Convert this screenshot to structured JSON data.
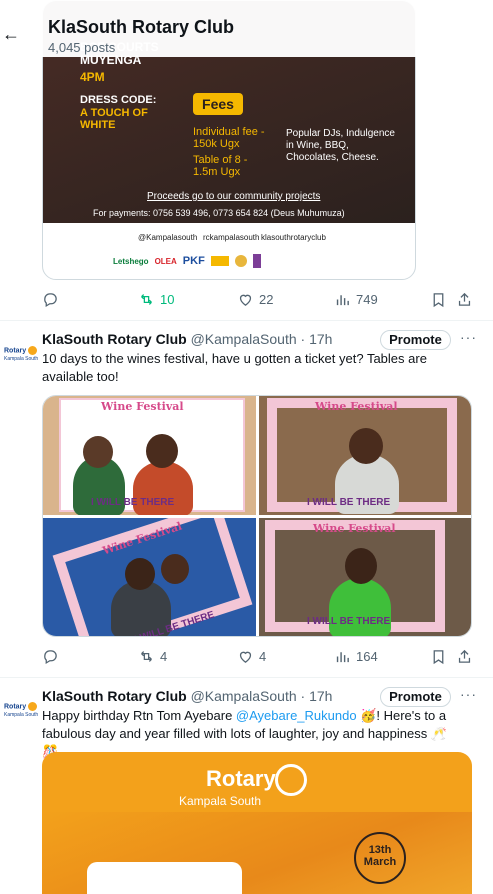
{
  "header": {
    "back_icon": "arrow-left-icon",
    "title": "KlaSouth Rotary Club",
    "posts_count": "4,045 posts"
  },
  "post1": {
    "flyer": {
      "venue": "BCF COURTS MUYENGA",
      "time": "4PM",
      "dress_code_label": "DRESS CODE:",
      "dress_code_value": "A TOUCH OF WHITE",
      "fees_label": "Fees",
      "individual_fee": "Individual fee - 150k Ugx",
      "table_fee": "Table of 8 - 1.5m Ugx",
      "popular": "Popular DJs, Indulgence in Wine, BBQ, Chocolates, Cheese.",
      "proceeds": "Proceeds go to our community projects",
      "payments": "For payments: 0756 539 496, 0773 654 824 (Deus Muhumuza)",
      "social_1": "@Kampalasouth",
      "social_2": "rckampalasouth",
      "social_3": "klasouthrotaryclub",
      "sponsor_1": "Letshego",
      "sponsor_2": "OLEA",
      "sponsor_3": "PKF"
    },
    "actions": {
      "retweets": "10",
      "likes": "22",
      "views": "749"
    }
  },
  "post2": {
    "avatar_text": "Rotary",
    "avatar_sub": "Kampala South",
    "author": "KlaSouth Rotary Club",
    "handle": "@KampalaSouth",
    "time": "· 17h",
    "promote_label": "Promote",
    "text": "10 days to the wines festival, have u gotten a ticket yet? Tables are available too!",
    "photo_frame_title": "Wine Festival",
    "photo_frame_tagline": "I WILL BE THERE",
    "actions": {
      "replies": "",
      "retweets": "4",
      "likes": "4",
      "views": "164"
    }
  },
  "post3": {
    "avatar_text": "Rotary",
    "avatar_sub": "Kampala South",
    "author": "KlaSouth Rotary Club",
    "handle": "@KampalaSouth",
    "time": "· 17h",
    "promote_label": "Promote",
    "text_before": "Happy birthday Rtn Tom Ayebare ",
    "mention": "@Ayebare_Rukundo",
    "text_after": " 🥳! Here's to a fabulous day and year filled with lots of laughter, joy and happiness 🥂🎊",
    "card_title": "Rotary",
    "card_subtitle": "Kampala South",
    "card_badge_day": "13th",
    "card_badge_month": "March"
  },
  "colors": {
    "accent": "#1d9bf0",
    "retweet_green": "#00ba7c",
    "rotary_gold": "#f7a81b",
    "rotary_blue": "#17458f"
  }
}
